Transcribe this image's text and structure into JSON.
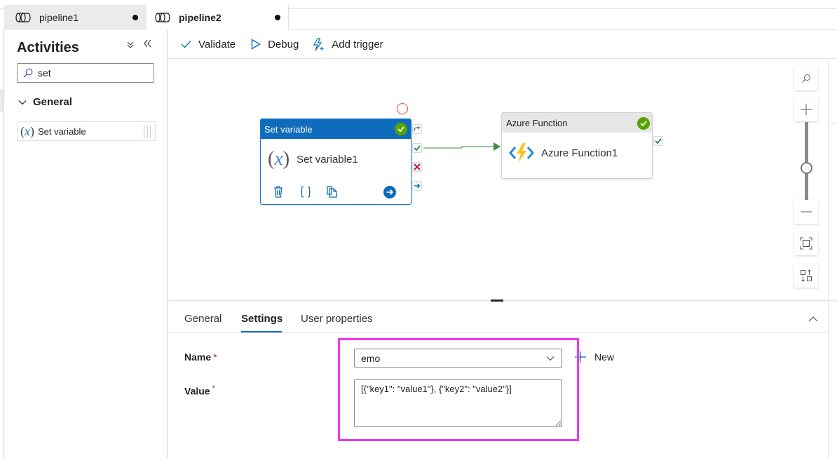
{
  "tabs": [
    {
      "label": "pipeline1",
      "icon": "pipeline-icon",
      "unsaved": true,
      "active": false
    },
    {
      "label": "pipeline2",
      "icon": "pipeline-icon",
      "unsaved": true,
      "active": true
    }
  ],
  "activities_panel": {
    "title": "Activities",
    "collapse_all_glyph": "»",
    "collapse_panel_glyph": "«",
    "search": {
      "value": "set",
      "placeholder": ""
    },
    "group": {
      "label": "General",
      "expanded": true
    },
    "items": [
      {
        "label": "Set variable",
        "icon": "set-variable-icon",
        "icon_text_left": "(",
        "icon_text_mid": "x",
        "icon_text_right": ")"
      }
    ]
  },
  "toolbar": {
    "validate_label": "Validate",
    "debug_label": "Debug",
    "add_trigger_label": "Add trigger"
  },
  "canvas": {
    "nodes": [
      {
        "type": "Set variable",
        "name": "Set variable1",
        "selected": true,
        "status": "valid",
        "icon_left": "(",
        "icon_mid": "x",
        "icon_right": ")"
      },
      {
        "type": "Azure Function",
        "name": "Azure Function1",
        "selected": false,
        "status": "valid"
      }
    ],
    "connection": {
      "from": "Set variable1",
      "to": "Azure Function1",
      "condition": "on-success"
    },
    "colors": {
      "header_selected": "#0f6cbd",
      "success": "#57a300",
      "arrow": "#4b9a4b",
      "fail": "#c50f1f",
      "breakpoint": "#e8484c"
    }
  },
  "properties": {
    "tabs": [
      {
        "label": "General",
        "active": false
      },
      {
        "label": "Settings",
        "active": true
      },
      {
        "label": "User properties",
        "active": false
      }
    ],
    "fields": {
      "name_label": "Name",
      "value_label": "Value",
      "required_marker": "*",
      "name_value": "emo",
      "value_value": "[{\"key1\": \"value1\"}, {\"key2\": \"value2\"}]",
      "new_label": "New"
    },
    "highlight_color": "#f038f0"
  }
}
